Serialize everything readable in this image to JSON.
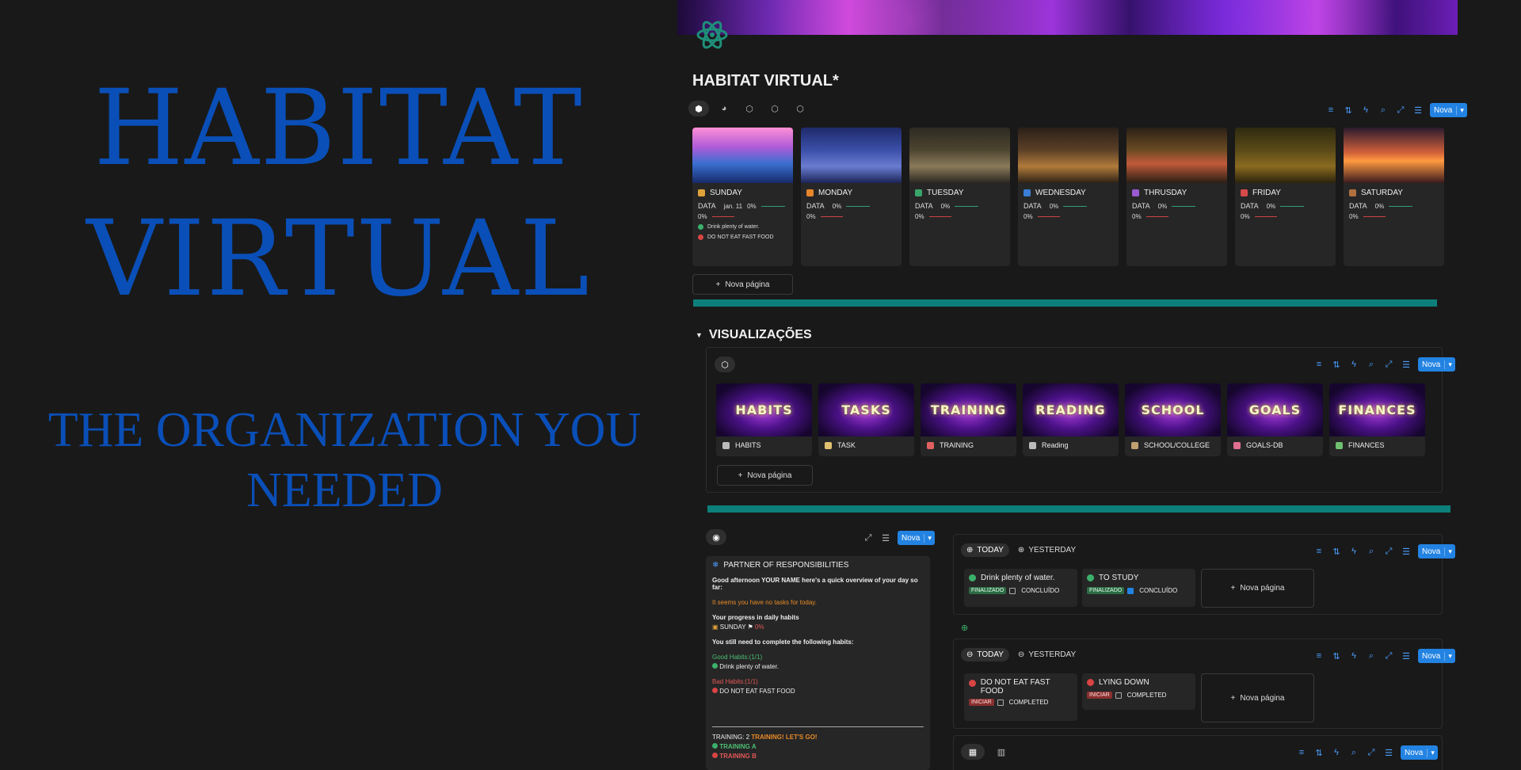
{
  "hero": {
    "line1": "HABITAT",
    "line2": "VIRTUAL",
    "subtitle": "THE ORGANIZATION YOU NEEDED"
  },
  "page": {
    "title": "HABITAT VIRTUAL*",
    "nova": "Nova",
    "new_page": "Nova página"
  },
  "days": [
    {
      "name": "SUNDAY",
      "data_label": "DATA",
      "date": "jan. 11",
      "pct": "0%",
      "pct2": "0%",
      "color": "#e0a23a",
      "img": "linear-gradient(180deg,#ff8fd6 0%,#b05bd8 35%,#3a6fd0 65%,#172a6a 100%)",
      "habits": [
        {
          "label": "Drink plenty of water.",
          "color": "#3bb06b"
        },
        {
          "label": "DO NOT EAT FAST FOOD",
          "color": "#d94444"
        }
      ]
    },
    {
      "name": "MONDAY",
      "data_label": "DATA",
      "date": "",
      "pct": "0%",
      "pct2": "0%",
      "color": "#e8862a",
      "img": "linear-gradient(180deg,#1e2a6a 0%,#3a4fa8 40%,#6a7cd0 70%,#1a2458 100%)",
      "habits": []
    },
    {
      "name": "TUESDAY",
      "data_label": "DATA",
      "date": "",
      "pct": "0%",
      "pct2": "0%",
      "color": "#3aa56a",
      "img": "linear-gradient(180deg,#2b2a22 0%,#4d4430 40%,#8a7a5a 70%,#2b2620 100%)",
      "habits": []
    },
    {
      "name": "WEDNESDAY",
      "data_label": "DATA",
      "date": "",
      "pct": "0%",
      "pct2": "0%",
      "color": "#3a7ed8",
      "img": "linear-gradient(180deg,#2a2018 0%,#5a3f26 40%,#b07a3a 70%,#2e2216 100%)",
      "habits": []
    },
    {
      "name": "THRUSDAY",
      "data_label": "DATA",
      "date": "",
      "pct": "0%",
      "pct2": "0%",
      "color": "#9a5ad0",
      "img": "linear-gradient(180deg,#2a2016 0%,#6a4a22 40%,#c05a3a 65%,#2a1e14 100%)",
      "habits": []
    },
    {
      "name": "FRIDAY",
      "data_label": "DATA",
      "date": "",
      "pct": "0%",
      "pct2": "0%",
      "color": "#d64a4a",
      "img": "linear-gradient(180deg,#2e2a10 0%,#5a4a18 40%,#8a6a20 70%,#2a220c 100%)",
      "habits": []
    },
    {
      "name": "SATURDAY",
      "data_label": "DATA",
      "date": "",
      "pct": "0%",
      "pct2": "0%",
      "color": "#b07040",
      "img": "linear-gradient(180deg,#2a1a2e 0%,#d0603a 45%,#ff9a40 60%,#3a1a1e 100%)",
      "habits": []
    }
  ],
  "views": {
    "title": "VISUALIZAÇÕES",
    "cards": [
      {
        "banner": "HABITS",
        "label": "HABITS",
        "icon_color": "#bbbbbb"
      },
      {
        "banner": "TASKS",
        "label": "TASK",
        "icon_color": "#e0c070"
      },
      {
        "banner": "TRAINING",
        "label": "TRAINING",
        "icon_color": "#e06060"
      },
      {
        "banner": "READING",
        "label": "Reading",
        "icon_color": "#bbbbbb"
      },
      {
        "banner": "SCHOOL",
        "label": "SCHOOL/COLLEGE",
        "icon_color": "#c0a070"
      },
      {
        "banner": "GOALS",
        "label": "GOALS-DB",
        "icon_color": "#e07090"
      },
      {
        "banner": "FINANCES",
        "label": "FINANCES",
        "icon_color": "#70c070"
      }
    ]
  },
  "partner": {
    "title": "PARTNER OF RESPONSIBILITIES",
    "greeting": "Good afternoon YOUR NAME here's a quick overview of your day so far:",
    "no_tasks": "It seems you have no tasks for today.",
    "progress_title": "Your progress in daily habits",
    "progress_day": "SUNDAY",
    "progress_pct": "0%",
    "complete_title": "You still need to complete the following habits:",
    "good_title": "Good Habits:(1/1)",
    "good_item": "Drink plenty of water.",
    "bad_title": "Bad Habits:(1/1)",
    "bad_item": "DO NOT EAT FAST FOOD",
    "training_prefix": "TRAINING: 2",
    "training_msg": "TRAINING! LET'S GO!",
    "training_a": "TRAINING A",
    "training_b": "TRAINING B"
  },
  "boards": {
    "today": "TODAY",
    "yesterday": "YESTERDAY",
    "good": [
      {
        "title": "Drink plenty of water.",
        "status": "FINALIZADO",
        "check_label": "CONCLUÍDO",
        "checked": false
      },
      {
        "title": "TO STUDY",
        "status": "FINALIZADO",
        "check_label": "CONCLUÍDO",
        "checked": true
      }
    ],
    "bad": [
      {
        "title": "DO NOT EAT FAST FOOD",
        "status": "INICIAR",
        "check_label": "COMPLETED",
        "checked": false
      },
      {
        "title": "LYING DOWN",
        "status": "INICIAR",
        "check_label": "COMPLETED",
        "checked": false
      }
    ]
  },
  "colors": {
    "accent": "#2383e2",
    "hero_blue": "#0a4fb8",
    "teal_divider": "#0d7f7a",
    "bg": "#191919"
  }
}
